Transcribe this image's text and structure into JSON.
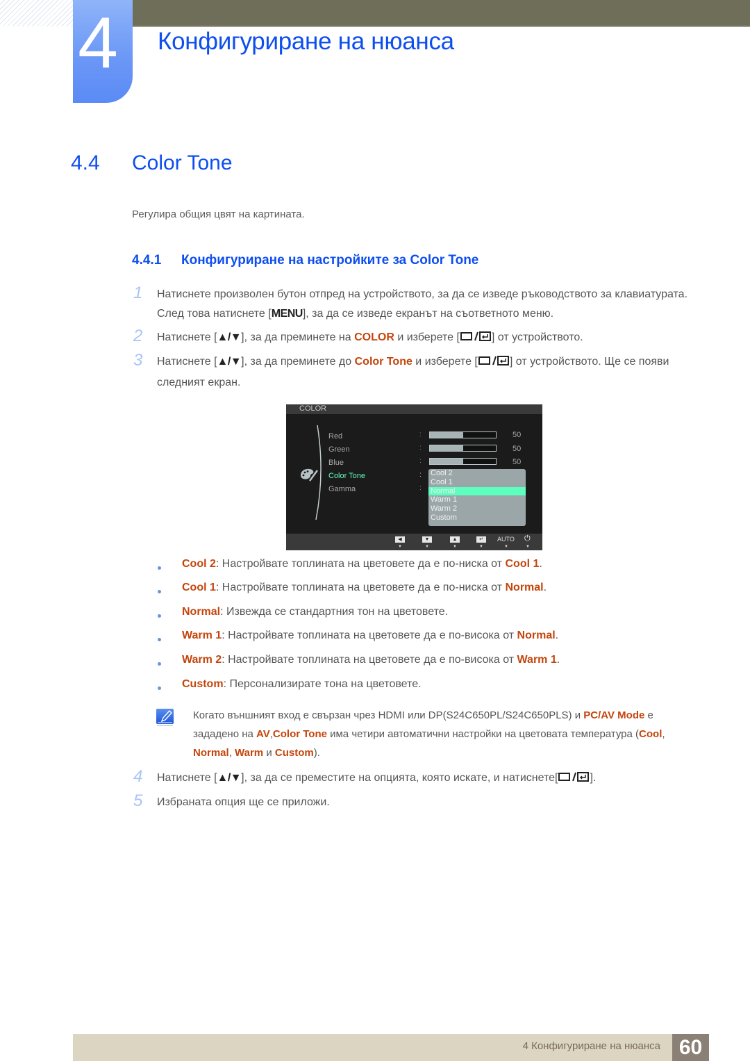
{
  "chapter": {
    "number": "4",
    "title": "Конфигуриране на нюанса"
  },
  "section": {
    "number": "4.4",
    "title": "Color Tone",
    "intro": "Регулира общия цвят на картината."
  },
  "subsection": {
    "number": "4.4.1",
    "title": "Конфигуриране на настройките за Color Tone"
  },
  "steps": [
    {
      "num": "1",
      "parts": [
        "Натиснете произволен бутон отпред на устройството, за да се изведе ръководството за клавиатурата. След това натиснете [",
        "MENU",
        "], за да се изведе екранът на съответното меню."
      ]
    },
    {
      "num": "2",
      "parts": [
        "Натиснете [",
        "▲/▼",
        "], за да преминете на ",
        "COLOR",
        " и изберете [",
        "",
        "] от устройството."
      ]
    },
    {
      "num": "3",
      "parts": [
        "Натиснете [",
        "▲/▼",
        "], за да преминете до ",
        "Color Tone",
        " и изберете [",
        "",
        "] от устройството. Ще се появи следният екран."
      ]
    },
    {
      "num": "4",
      "parts": [
        "Натиснете [",
        "▲/▼",
        "], за да се преместите на опцията, която искате, и натиснете[",
        "",
        "]."
      ]
    },
    {
      "num": "5",
      "parts": [
        "Избраната опция ще се приложи."
      ]
    }
  ],
  "osd": {
    "header": "COLOR",
    "items": [
      {
        "label": "Red",
        "value": "50",
        "fraction": 0.5
      },
      {
        "label": "Green",
        "value": "50",
        "fraction": 0.5
      },
      {
        "label": "Blue",
        "value": "50",
        "fraction": 0.5
      },
      {
        "label": "Color Tone",
        "active": true
      },
      {
        "label": "Gamma"
      }
    ],
    "colon": ":",
    "options": [
      "Cool 2",
      "Cool 1",
      "Normal",
      "Warm 1",
      "Warm 2",
      "Custom"
    ],
    "selected": "Normal",
    "footer_buttons": [
      "left-arrow",
      "down-arrow",
      "up-arrow",
      "enter",
      "AUTO",
      "power"
    ],
    "auto_label": "AUTO",
    "colors": {
      "active_item": "#5dffbe",
      "list_bg": "#9aa6a8"
    }
  },
  "bullets": [
    {
      "term": "Cool 2",
      "text": ": Настройвате топлината на цветовете да е по-ниска от ",
      "ref": "Cool 1",
      "end": "."
    },
    {
      "term": "Cool 1",
      "text": ": Настройвате топлината на цветовете да е по-ниска от ",
      "ref": "Normal",
      "end": "."
    },
    {
      "term": "Normal",
      "text": ": Извежда се стандартния тон на цветовете.",
      "ref": "",
      "end": ""
    },
    {
      "term": "Warm 1",
      "text": ": Настройвате топлината на цветовете да е по-висока от ",
      "ref": "Normal",
      "end": "."
    },
    {
      "term": "Warm 2",
      "text": ": Настройвате топлината на цветовете да е по-висока от ",
      "ref": "Warm 1",
      "end": "."
    },
    {
      "term": "Custom",
      "text": ": Персонализирате тона на цветовете.",
      "ref": "",
      "end": ""
    }
  ],
  "note": {
    "t1": "Когато външният вход е свързан чрез HDMI или DP(S24C650PL/S24C650PLS) и ",
    "h1": "PC/AV Mode",
    "t2": " е зададено на ",
    "h2": "AV",
    "t3": ",",
    "h3": "Color Tone",
    "t4": " има четири автоматични настройки на цветовата температура (",
    "h4": "Cool",
    "t5": ", ",
    "h5": "Normal",
    "t6": ", ",
    "h6": "Warm",
    "t7": " и ",
    "h7": "Custom",
    "t8": ")."
  },
  "footer": {
    "text": "4 Конфигуриране на нюанса",
    "page": "60"
  },
  "colors": {
    "heading_blue": "#0d4ef0",
    "highlight": "#c4450c",
    "step_num": "#a9c4f6",
    "topbar": "#6f6e59",
    "footer_bg": "#dbd5c1",
    "page_box": "#8b8075"
  }
}
